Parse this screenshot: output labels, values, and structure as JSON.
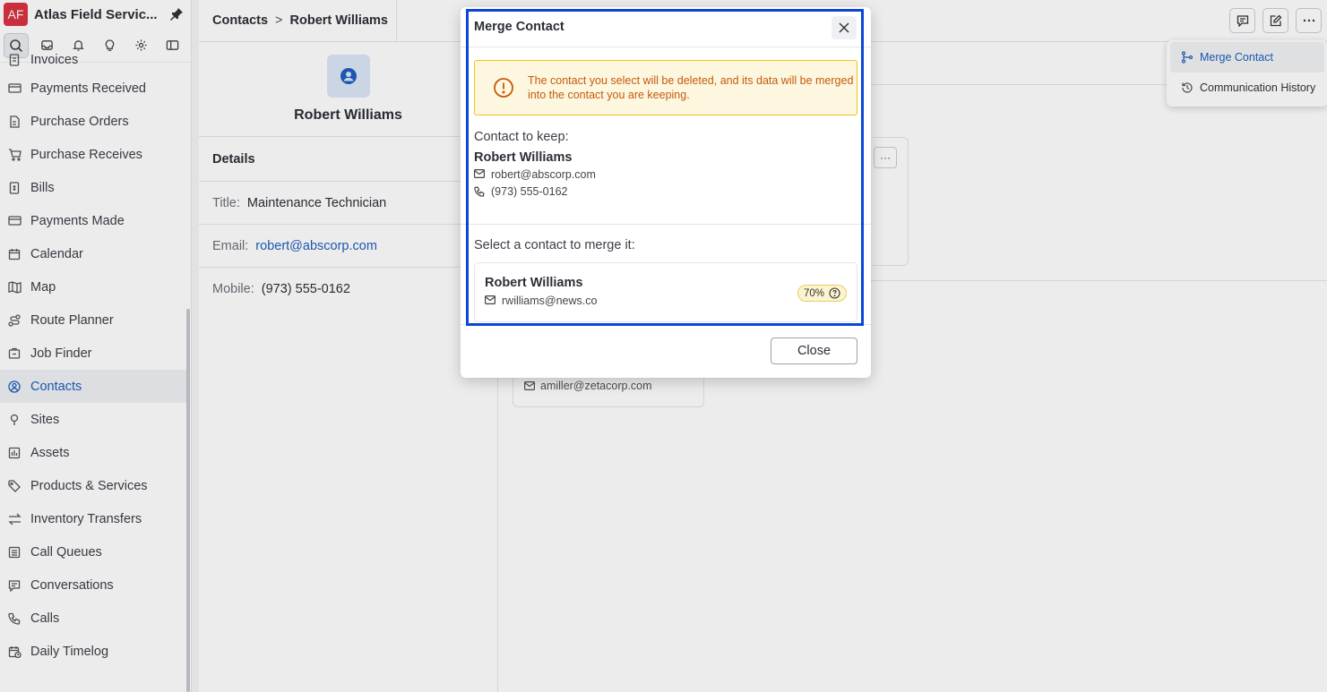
{
  "app": {
    "logo": "AF",
    "name": "Atlas Field Servic..."
  },
  "sidebar": {
    "items": [
      {
        "label": "Invoices",
        "icon": "invoice-icon"
      },
      {
        "label": "Payments Received",
        "icon": "card-icon"
      },
      {
        "label": "Purchase Orders",
        "icon": "document-icon"
      },
      {
        "label": "Purchase Receives",
        "icon": "cart-icon"
      },
      {
        "label": "Bills",
        "icon": "bill-icon"
      },
      {
        "label": "Payments Made",
        "icon": "card-icon"
      },
      {
        "label": "Calendar",
        "icon": "calendar-icon"
      },
      {
        "label": "Map",
        "icon": "map-icon"
      },
      {
        "label": "Route Planner",
        "icon": "route-icon"
      },
      {
        "label": "Job Finder",
        "icon": "job-finder-icon"
      },
      {
        "label": "Contacts",
        "icon": "contact-icon"
      },
      {
        "label": "Sites",
        "icon": "pin-location-icon"
      },
      {
        "label": "Assets",
        "icon": "asset-icon"
      },
      {
        "label": "Products & Services",
        "icon": "tag-icon"
      },
      {
        "label": "Inventory Transfers",
        "icon": "transfer-icon"
      },
      {
        "label": "Call Queues",
        "icon": "queue-icon"
      },
      {
        "label": "Conversations",
        "icon": "chat-icon"
      },
      {
        "label": "Calls",
        "icon": "phone-icon"
      },
      {
        "label": "Daily Timelog",
        "icon": "timelog-icon"
      }
    ],
    "active": "Contacts"
  },
  "breadcrumb": {
    "parent": "Contacts",
    "separator": ">",
    "current": "Robert Williams"
  },
  "profile": {
    "name": "Robert Williams"
  },
  "details": {
    "heading": "Details",
    "title_label": "Title:",
    "title_value": "Maintenance Technician",
    "email_label": "Email:",
    "email_value": "robert@abscorp.com",
    "mobile_label": "Mobile:",
    "mobile_value": "(973) 555-0162"
  },
  "background": {
    "card_more": "···",
    "sub_email": "amiller@zetacorp.com"
  },
  "dropdown": {
    "items": [
      {
        "label": "Merge Contact",
        "icon": "merge-icon"
      },
      {
        "label": "Communication History",
        "icon": "history-icon"
      }
    ]
  },
  "modal": {
    "title": "Merge Contact",
    "warning": "The contact you select will be deleted, and its data will be merged into the contact you are keeping.",
    "keep_label": "Contact to keep:",
    "keep_name": "Robert Williams",
    "keep_email": "robert@abscorp.com",
    "keep_phone": "(973) 555-0162",
    "merge_label": "Select a contact to merge it:",
    "candidate": {
      "name": "Robert Williams",
      "email": "rwilliams@news.co",
      "match": "70%"
    },
    "close_label": "Close"
  },
  "colors": {
    "accent": "#1f5fbf",
    "brand": "#d9333f",
    "warning": "#c35a0b",
    "highlight": "#0a47d6"
  }
}
